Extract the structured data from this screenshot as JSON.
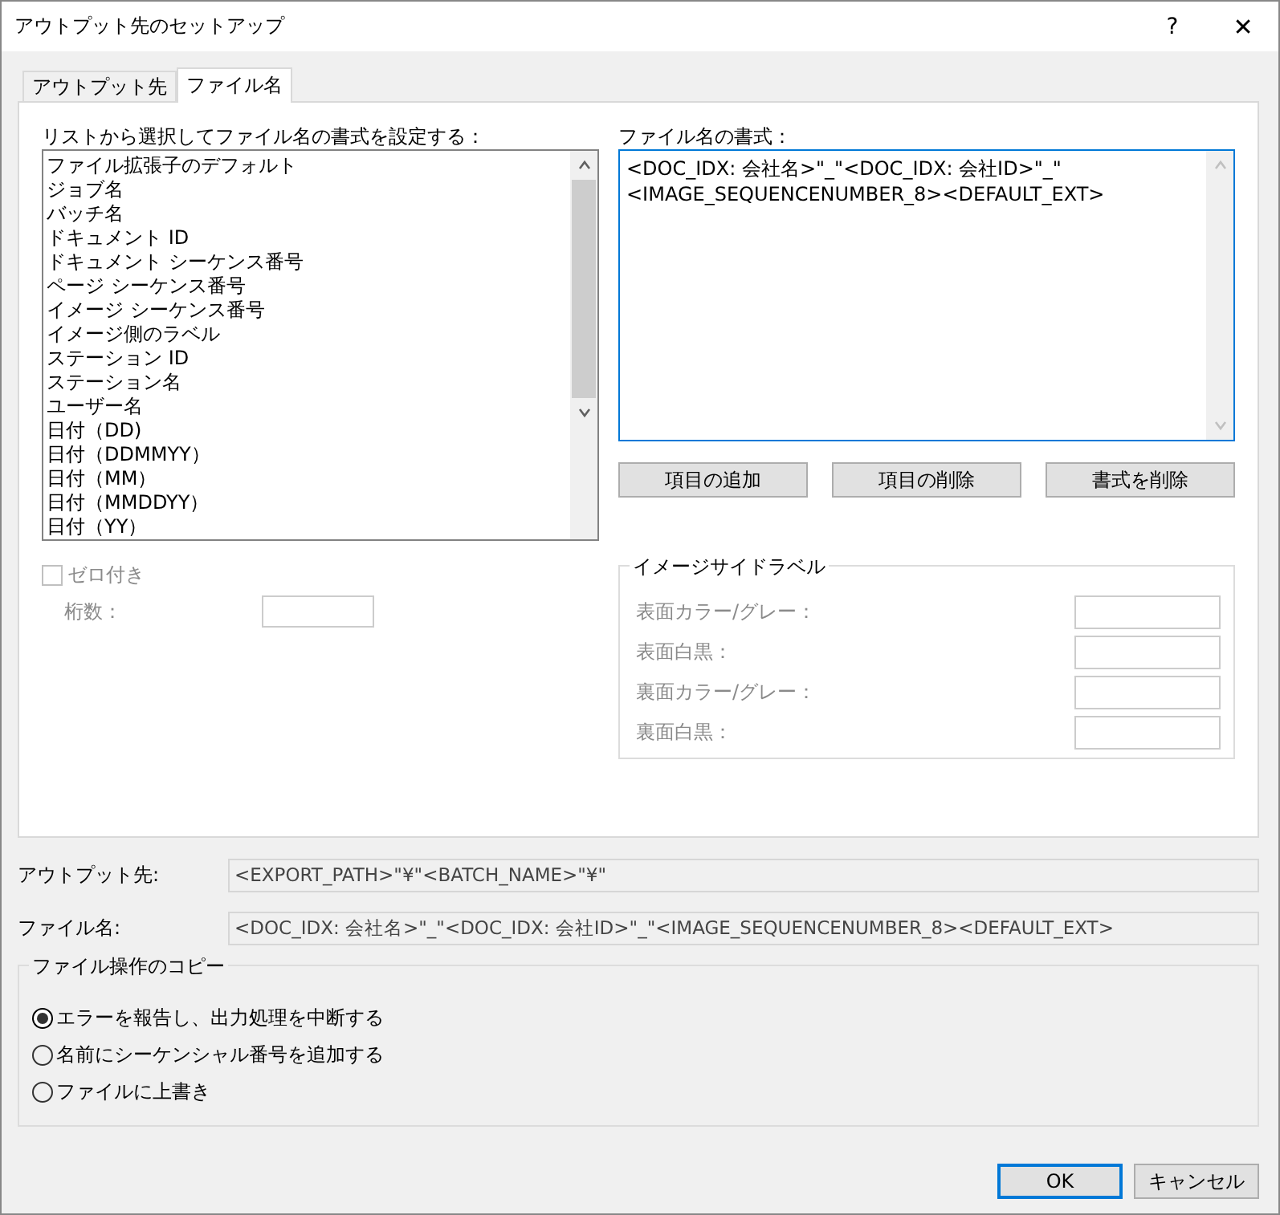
{
  "window": {
    "title": "アウトプット先のセットアップ",
    "help": "?",
    "close": "✕"
  },
  "tabs": [
    {
      "label": "アウトプット先",
      "selected": false
    },
    {
      "label": "ファイル名",
      "selected": true
    }
  ],
  "list": {
    "label": "リストから選択してファイル名の書式を設定する：",
    "items": [
      "ファイル拡張子のデフォルト",
      "ジョブ名",
      "バッチ名",
      "ドキュメント ID",
      "ドキュメント シーケンス番号",
      "ページ シーケンス番号",
      "イメージ シーケンス番号",
      "イメージ側のラベル",
      "ステーション ID",
      "ステーション名",
      "ユーザー名",
      "日付（DD)",
      "日付（DDMMYY）",
      "日付（MM）",
      "日付（MMDDYY）",
      "日付（YY）"
    ]
  },
  "format": {
    "label": "ファイル名の書式：",
    "value": "<DOC_IDX: 会社名>\"_\"<DOC_IDX: 会社ID>\"_\"<IMAGE_SEQUENCENUMBER_8><DEFAULT_EXT>"
  },
  "format_buttons": [
    "項目の追加",
    "項目の削除",
    "書式を削除"
  ],
  "zero_pad": {
    "label": "ゼロ付き",
    "checked": false,
    "disabled": true,
    "digits_label": "桁数："
  },
  "image_side_label": {
    "title": "イメージサイドラベル",
    "disabled": true,
    "fields": [
      "表面カラー/グレー：",
      "表面白黒：",
      "裏面カラー/グレー：",
      "裏面白黒："
    ]
  },
  "output_rows": [
    {
      "label": "アウトプット先:",
      "value": "<EXPORT_PATH>\"¥\"<BATCH_NAME>\"¥\""
    },
    {
      "label": "ファイル名:",
      "value": "<DOC_IDX: 会社名>\"_\"<DOC_IDX: 会社ID>\"_\"<IMAGE_SEQUENCENUMBER_8><DEFAULT_EXT>"
    }
  ],
  "copy_options": {
    "title": "ファイル操作のコピー",
    "options": [
      {
        "label": "エラーを報告し、出力処理を中断する",
        "selected": true
      },
      {
        "label": "名前にシーケンシャル番号を追加する",
        "selected": false
      },
      {
        "label": "ファイルに上書き",
        "selected": false
      }
    ]
  },
  "buttons": [
    {
      "label": "OK",
      "kind": "default"
    },
    {
      "label": "キャンセル",
      "kind": "normal"
    }
  ]
}
